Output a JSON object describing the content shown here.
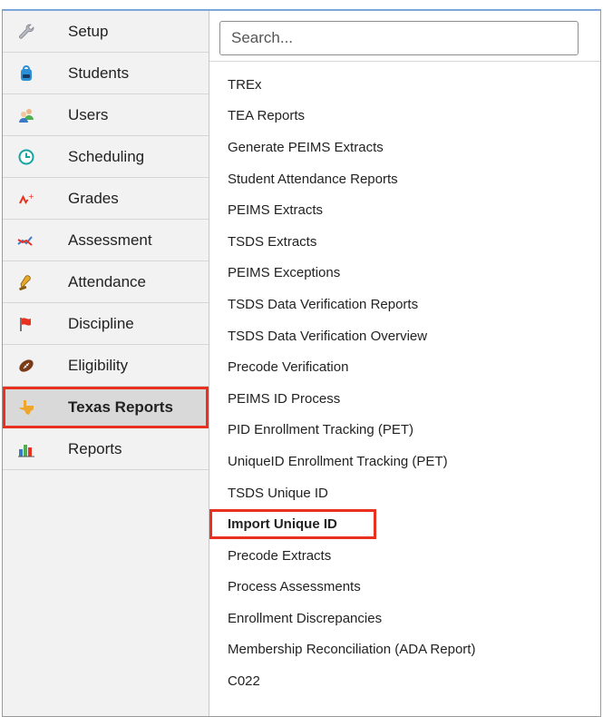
{
  "sidebar": {
    "items": [
      {
        "label": "Setup",
        "icon": "wrench-icon"
      },
      {
        "label": "Students",
        "icon": "backpack-icon"
      },
      {
        "label": "Users",
        "icon": "users-icon"
      },
      {
        "label": "Scheduling",
        "icon": "clock-icon"
      },
      {
        "label": "Grades",
        "icon": "grade-icon"
      },
      {
        "label": "Assessment",
        "icon": "chart-line-icon"
      },
      {
        "label": "Attendance",
        "icon": "bell-icon"
      },
      {
        "label": "Discipline",
        "icon": "flag-icon"
      },
      {
        "label": "Eligibility",
        "icon": "football-icon"
      },
      {
        "label": "Texas Reports",
        "icon": "texas-icon"
      },
      {
        "label": "Reports",
        "icon": "bar-chart-icon"
      }
    ],
    "active_index": 9
  },
  "search": {
    "placeholder": "Search..."
  },
  "reports": {
    "items": [
      "TREx",
      "TEA Reports",
      "Generate PEIMS Extracts",
      "Student Attendance Reports",
      "PEIMS Extracts",
      "TSDS Extracts",
      "PEIMS Exceptions",
      "TSDS Data Verification Reports",
      "TSDS Data Verification Overview",
      "Precode Verification",
      "PEIMS ID Process",
      "PID Enrollment Tracking (PET)",
      "UniqueID Enrollment Tracking (PET)",
      "TSDS Unique ID",
      "Import Unique ID",
      "Precode Extracts",
      "Process Assessments",
      "Enrollment Discrepancies",
      "Membership Reconciliation (ADA Report)",
      "C022"
    ],
    "active_index": 14
  },
  "colors": {
    "highlight": "#e8311e",
    "sidebar_bg": "#f2f2f2",
    "active_bg": "#d9d9d9"
  }
}
